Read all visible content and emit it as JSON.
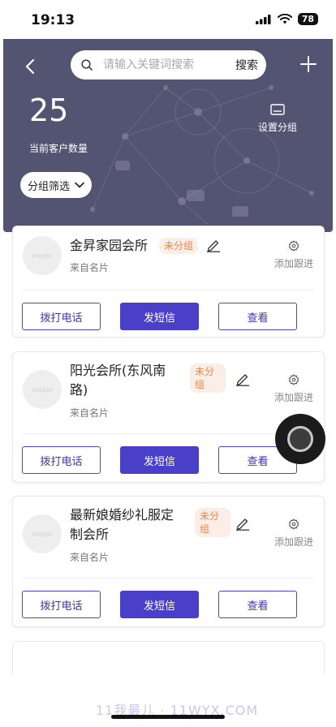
{
  "status_bar": {
    "time": "19:13",
    "battery": "78"
  },
  "header": {
    "search_placeholder": "请输入关键词搜索",
    "search_button": "搜索",
    "customer_count": "25",
    "customer_count_label": "当前客户数量",
    "group_settings": "设置分组",
    "group_filter": "分组筛选",
    "background_color": "#535372"
  },
  "cards": [
    {
      "avatar_text": "mopin",
      "name": "金昇家园会所",
      "name_line2": "",
      "group_badge": "未分组",
      "source": "来自名片",
      "follow_label": "添加跟进",
      "call_button": "拨打电话",
      "sms_button": "发短信",
      "view_button": "查看"
    },
    {
      "avatar_text": "mopin",
      "name": "阳光会所(东风南",
      "name_line2": "路)",
      "group_badge": "未分组",
      "source": "来自名片",
      "follow_label": "添加跟进",
      "call_button": "拨打电话",
      "sms_button": "发短信",
      "view_button": "查看"
    },
    {
      "avatar_text": "mopin",
      "name": "最新娘婚纱礼服定",
      "name_line2": "制会所",
      "group_badge": "未分组",
      "source": "来自名片",
      "follow_label": "添加跟进",
      "call_button": "拨打电话",
      "sms_button": "发短信",
      "view_button": "查看"
    }
  ],
  "watermark": "11我最儿 · 11WYX.COM",
  "colors": {
    "primary": "#4a40c8",
    "badge_bg": "#fbeee6",
    "badge_text": "#e6874f"
  }
}
